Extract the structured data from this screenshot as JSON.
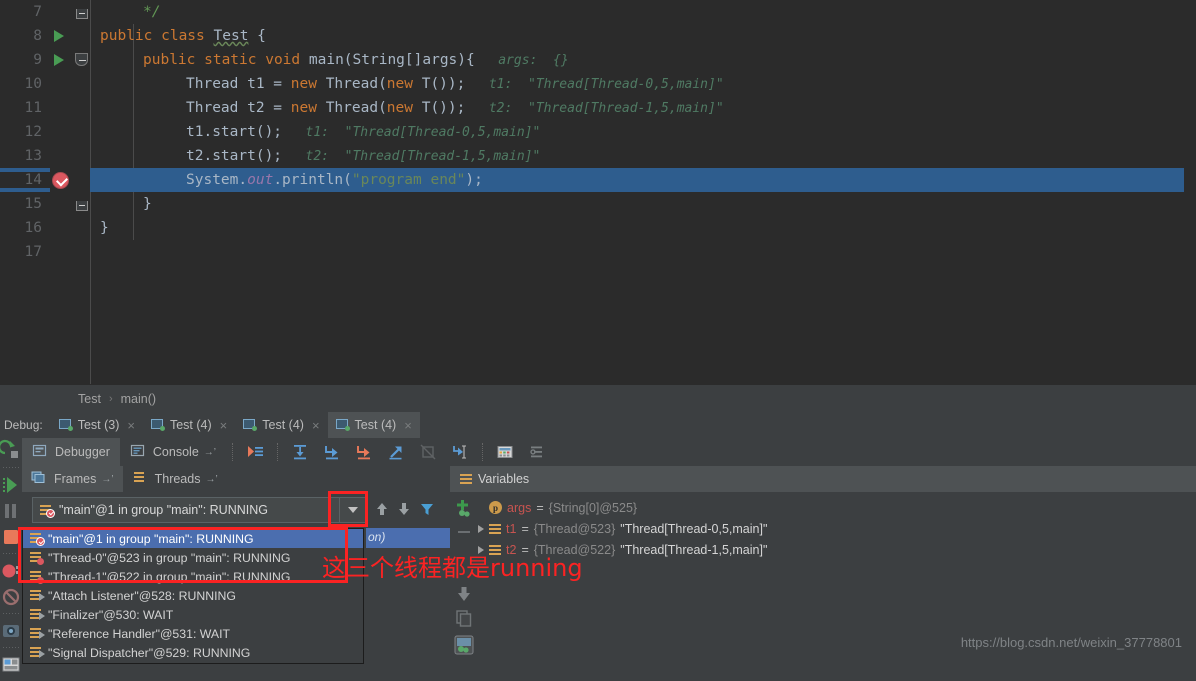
{
  "editor": {
    "lines": [
      {
        "num": "7",
        "gutter": "fold-top",
        "indent": 1,
        "tokens": [
          {
            "t": "*/",
            "c": "cmt"
          }
        ]
      },
      {
        "num": "8",
        "gutter": "run",
        "indent": 0,
        "tokens": [
          {
            "t": "public ",
            "c": "kw"
          },
          {
            "t": "class ",
            "c": "kw"
          },
          {
            "t": "Test",
            "c": "cls squig"
          },
          {
            "t": " {",
            "c": "pln"
          }
        ]
      },
      {
        "num": "9",
        "gutter": "run",
        "indent": 1,
        "tokens": [
          {
            "t": "public ",
            "c": "kw"
          },
          {
            "t": "static ",
            "c": "kw"
          },
          {
            "t": "void ",
            "c": "kw"
          },
          {
            "t": "main",
            "c": "cls"
          },
          {
            "t": "(String[]args){",
            "c": "pln"
          },
          {
            "t": "   args:  {}",
            "c": "hint"
          }
        ]
      },
      {
        "num": "10",
        "gutter": "",
        "indent": 2,
        "tokens": [
          {
            "t": "Thread t1 = ",
            "c": "pln"
          },
          {
            "t": "new ",
            "c": "kw"
          },
          {
            "t": "Thread(",
            "c": "pln"
          },
          {
            "t": "new ",
            "c": "kw"
          },
          {
            "t": "T());",
            "c": "pln"
          },
          {
            "t": "   t1:  \"Thread[Thread-0,5,main]\"",
            "c": "hint"
          }
        ]
      },
      {
        "num": "11",
        "gutter": "",
        "indent": 2,
        "tokens": [
          {
            "t": "Thread t2 = ",
            "c": "pln"
          },
          {
            "t": "new ",
            "c": "kw"
          },
          {
            "t": "Thread(",
            "c": "pln"
          },
          {
            "t": "new ",
            "c": "kw"
          },
          {
            "t": "T());",
            "c": "pln"
          },
          {
            "t": "   t2:  \"Thread[Thread-1,5,main]\"",
            "c": "hint"
          }
        ]
      },
      {
        "num": "12",
        "gutter": "",
        "indent": 2,
        "tokens": [
          {
            "t": "t1.start();",
            "c": "pln"
          },
          {
            "t": "   t1:  \"Thread[Thread-0,5,main]\"",
            "c": "hint"
          }
        ]
      },
      {
        "num": "13",
        "gutter": "",
        "indent": 2,
        "tokens": [
          {
            "t": "t2.start();",
            "c": "pln"
          },
          {
            "t": "   t2:  \"Thread[Thread-1,5,main]\"",
            "c": "hint"
          }
        ]
      },
      {
        "num": "14",
        "gutter": "breakpoint",
        "indent": 2,
        "selected": true,
        "tokens": [
          {
            "t": "System.",
            "c": "pln"
          },
          {
            "t": "out",
            "c": "fld"
          },
          {
            "t": ".println(",
            "c": "pln"
          },
          {
            "t": "\"program end\"",
            "c": "str"
          },
          {
            "t": ");",
            "c": "pln"
          }
        ]
      },
      {
        "num": "15",
        "gutter": "fold-bot",
        "indent": 1,
        "tokens": [
          {
            "t": "}",
            "c": "pln"
          }
        ]
      },
      {
        "num": "16",
        "gutter": "",
        "indent": 0,
        "tokens": [
          {
            "t": "}",
            "c": "pln"
          }
        ]
      },
      {
        "num": "17",
        "gutter": "",
        "indent": 0,
        "tokens": []
      }
    ]
  },
  "breadcrumb": {
    "class": "Test",
    "separator": "›",
    "method": "main()"
  },
  "debug_tabs": {
    "label": "Debug:",
    "tabs": [
      {
        "title": "Test (3)",
        "close": "×",
        "active": false
      },
      {
        "title": "Test (4)",
        "close": "×",
        "active": false
      },
      {
        "title": "Test (4)",
        "close": "×",
        "active": false
      },
      {
        "title": "Test (4)",
        "close": "×",
        "active": true
      }
    ]
  },
  "debugger_toolbar": {
    "subtabs": [
      {
        "label": "Debugger",
        "active": true,
        "icon": "debugger-icon"
      },
      {
        "label": "Console",
        "active": false,
        "icon": "console-icon",
        "pin": "→’"
      }
    ],
    "buttons": [
      {
        "name": "show-execution-point-icon"
      },
      {
        "name": "step-over-icon"
      },
      {
        "name": "step-into-icon"
      },
      {
        "name": "force-step-into-icon"
      },
      {
        "name": "step-out-icon"
      },
      {
        "name": "drop-frame-icon"
      },
      {
        "name": "run-to-cursor-icon"
      },
      {
        "name": "evaluate-expression-icon"
      },
      {
        "name": "settings-icon"
      }
    ]
  },
  "left_rail": {
    "buttons": [
      {
        "name": "rerun-icon"
      },
      {
        "name": "resume-program-icon"
      },
      {
        "name": "pause-program-icon"
      },
      {
        "name": "stop-icon"
      },
      {
        "name": "view-breakpoints-icon"
      },
      {
        "name": "mute-breakpoints-icon"
      },
      {
        "name": "settings-camera-icon"
      },
      {
        "name": "layout-settings-icon"
      }
    ]
  },
  "frames_panel": {
    "tabs": [
      {
        "label": "Frames",
        "active": true,
        "pin": "→’",
        "icon": "frames-icon"
      },
      {
        "label": "Threads",
        "active": false,
        "pin": "→’",
        "icon": "threads-icon"
      }
    ],
    "thread_selector": {
      "value": "\"main\"@1 in group \"main\": RUNNING",
      "arrow": "chevron-down-icon"
    },
    "nav_buttons": [
      {
        "name": "move-up-icon"
      },
      {
        "name": "move-down-icon"
      },
      {
        "name": "filter-icon"
      }
    ],
    "hidden_frame_text": "on)"
  },
  "thread_dropdown": {
    "items": [
      {
        "text": "\"main\"@1 in group \"main\": RUNNING",
        "icon": "thread-main-running-icon",
        "selected": true
      },
      {
        "text": "\"Thread-0\"@523 in group \"main\": RUNNING",
        "icon": "thread-suspended-icon",
        "selected": false
      },
      {
        "text": "\"Thread-1\"@522 in group \"main\": RUNNING",
        "icon": "thread-suspended-icon",
        "selected": false
      },
      {
        "text": "\"Attach Listener\"@528: RUNNING",
        "icon": "thread-running-icon",
        "selected": false
      },
      {
        "text": "\"Finalizer\"@530: WAIT",
        "icon": "thread-running-icon",
        "selected": false
      },
      {
        "text": "\"Reference Handler\"@531: WAIT",
        "icon": "thread-running-icon",
        "selected": false
      },
      {
        "text": "\"Signal Dispatcher\"@529: RUNNING",
        "icon": "thread-running-icon",
        "selected": false
      }
    ]
  },
  "annotation": {
    "text": "这三个线程都是running",
    "color": "#fb2323"
  },
  "variables": {
    "title": "Variables",
    "rail_buttons": [
      {
        "name": "add-watch-icon"
      },
      {
        "name": "remove-watch-icon"
      },
      {
        "name": "move-down-watch-icon"
      },
      {
        "name": "copy-value-icon"
      },
      {
        "name": "inspect-icon"
      }
    ],
    "rows": [
      {
        "expand": false,
        "icon": "parameter-icon",
        "name": "args",
        "eq": "=",
        "type": "{String[0]@525}",
        "value": ""
      },
      {
        "expand": true,
        "icon": "thread-field-icon",
        "name": "t1",
        "eq": "=",
        "type": "{Thread@523}",
        "value": "\"Thread[Thread-0,5,main]\""
      },
      {
        "expand": true,
        "icon": "thread-field-icon",
        "name": "t2",
        "eq": "=",
        "type": "{Thread@522}",
        "value": "\"Thread[Thread-1,5,main]\""
      }
    ]
  },
  "watermark": {
    "text": "https://blog.csdn.net/weixin_37778801"
  },
  "colors": {
    "editor_bg": "#2b2b2b",
    "panel_bg": "#3c3f41",
    "selection": "#2e5d8e",
    "list_selection": "#4b6eaf",
    "accent_red": "#fb2323",
    "keyword": "#cc7832",
    "string": "#6a8759",
    "hint": "#4f7a63",
    "field": "#9876aa",
    "var_name": "#c75450"
  }
}
